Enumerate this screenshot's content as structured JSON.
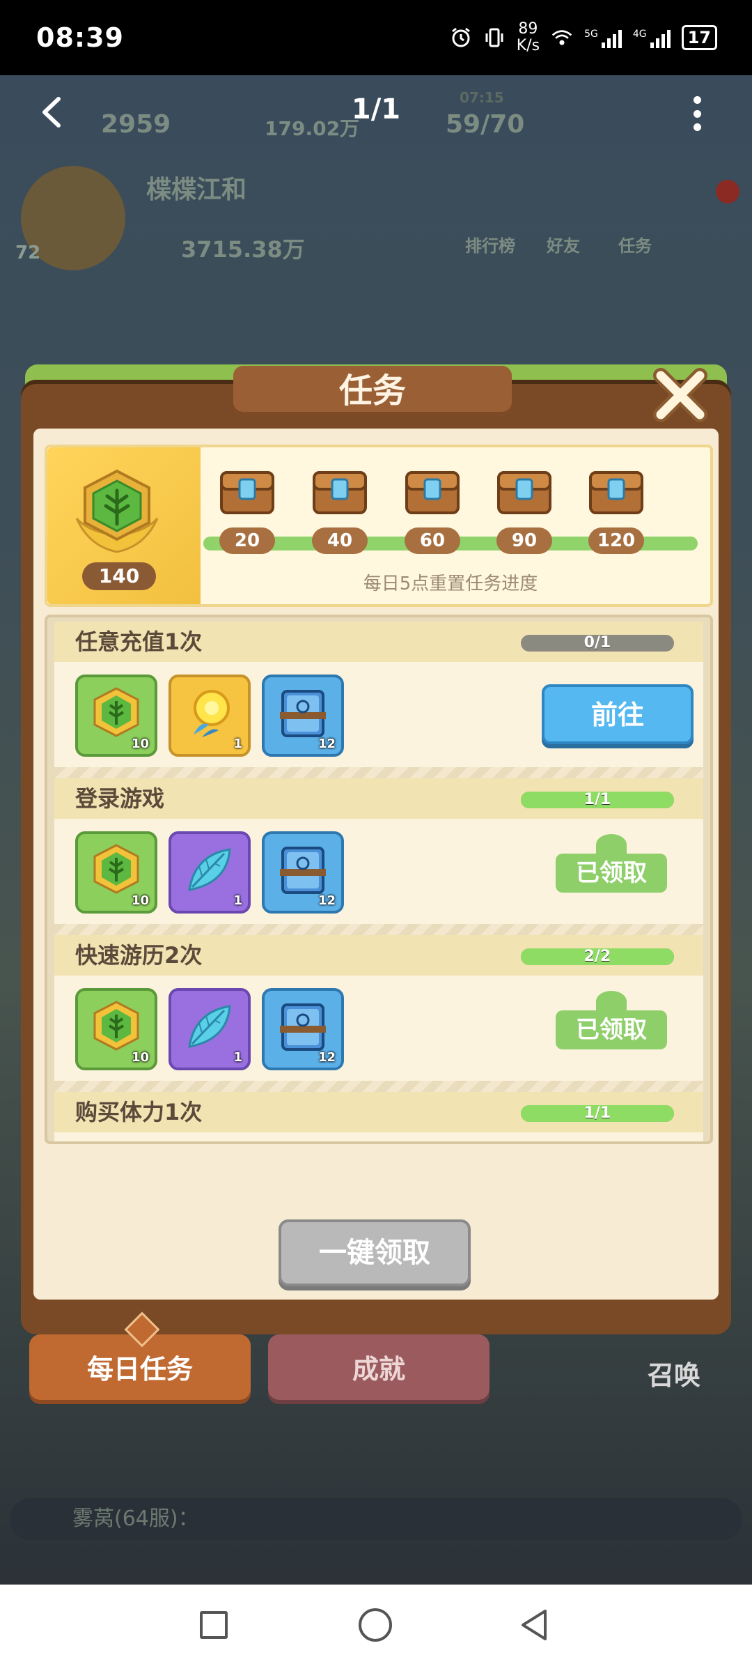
{
  "status_bar": {
    "time": "08:39",
    "speed_value": "89",
    "speed_unit": "K/s",
    "signal1_label": "5G",
    "signal2_label": "4G",
    "battery": "17"
  },
  "viewer": {
    "page_indicator": "1/1"
  },
  "background_hud": {
    "gems": "2959",
    "coins": "179.02万",
    "energy": "59/70",
    "energy_timer": "07:15",
    "player_name": "楪楪江和",
    "power": "3715.38万",
    "level": "72",
    "leaderboard": "排行榜",
    "friends": "好友",
    "tasks": "任务",
    "summon": "召唤",
    "chat": "雾莴(64服)："
  },
  "panel": {
    "title": "任务",
    "points": "140",
    "reset_note": "每日5点重置任务进度",
    "milestones": [
      "20",
      "40",
      "60",
      "90",
      "120"
    ],
    "one_click_claim": "一键领取"
  },
  "tasks": [
    {
      "name": "任意充值1次",
      "progress_text": "0/1",
      "progress_fraction": 0,
      "action": "前往",
      "status": "go",
      "rewards": [
        {
          "type": "activity-badge-icon",
          "count": "10",
          "color": "green"
        },
        {
          "type": "gold-gem-icon",
          "count": "1",
          "color": "gold"
        },
        {
          "type": "exp-book-icon",
          "count": "12",
          "color": "blue"
        }
      ]
    },
    {
      "name": "登录游戏",
      "progress_text": "1/1",
      "progress_fraction": 1,
      "action": "已领取",
      "status": "claimed",
      "rewards": [
        {
          "type": "activity-badge-icon",
          "count": "10",
          "color": "green"
        },
        {
          "type": "crystal-leaf-icon",
          "count": "1",
          "color": "purple"
        },
        {
          "type": "exp-book-icon",
          "count": "12",
          "color": "blue"
        }
      ]
    },
    {
      "name": "快速游历2次",
      "progress_text": "2/2",
      "progress_fraction": 1,
      "action": "已领取",
      "status": "claimed",
      "rewards": [
        {
          "type": "activity-badge-icon",
          "count": "10",
          "color": "green"
        },
        {
          "type": "crystal-leaf-icon",
          "count": "1",
          "color": "purple"
        },
        {
          "type": "exp-book-icon",
          "count": "12",
          "color": "blue"
        }
      ]
    },
    {
      "name": "购买体力1次",
      "progress_text": "1/1",
      "progress_fraction": 1,
      "action": "",
      "status": "claimed",
      "rewards": [
        {
          "type": "activity-badge-icon",
          "count": "",
          "color": "green"
        },
        {
          "type": "crystal-leaf-icon",
          "count": "",
          "color": "purple"
        },
        {
          "type": "exp-book-icon",
          "count": "",
          "color": "blue"
        }
      ]
    }
  ],
  "tabs": {
    "daily": "每日任务",
    "achievements": "成就"
  }
}
